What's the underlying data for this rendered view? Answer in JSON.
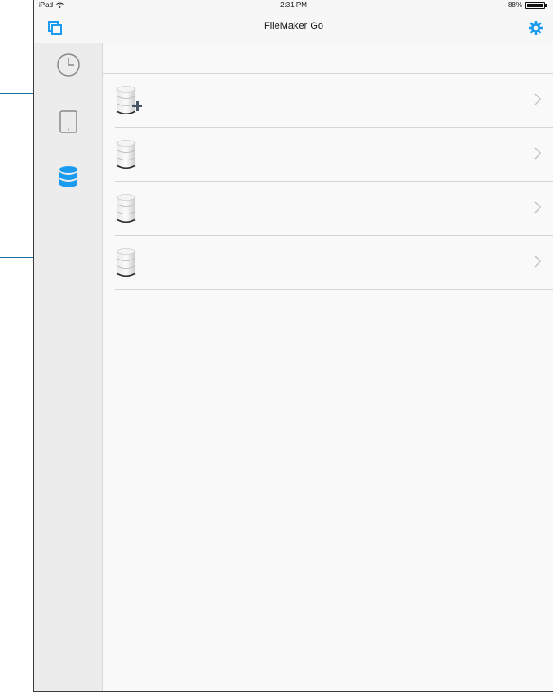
{
  "status": {
    "device": "iPad",
    "time": "2:31 PM",
    "battery": "88%",
    "battery_level": 0.88
  },
  "header": {
    "title": "FileMaker Go"
  },
  "sidebar": {
    "items": [
      {
        "icon": "clock-icon",
        "selected": false
      },
      {
        "icon": "ipad-icon",
        "selected": false
      },
      {
        "icon": "database-icon",
        "selected": true
      }
    ]
  },
  "list": {
    "rows": [
      {
        "icon": "database-add-icon"
      },
      {
        "icon": "database-icon"
      },
      {
        "icon": "database-icon"
      },
      {
        "icon": "database-icon"
      }
    ]
  },
  "colors": {
    "accent": "#1a9bf0",
    "callout": "#1b6e9e"
  }
}
